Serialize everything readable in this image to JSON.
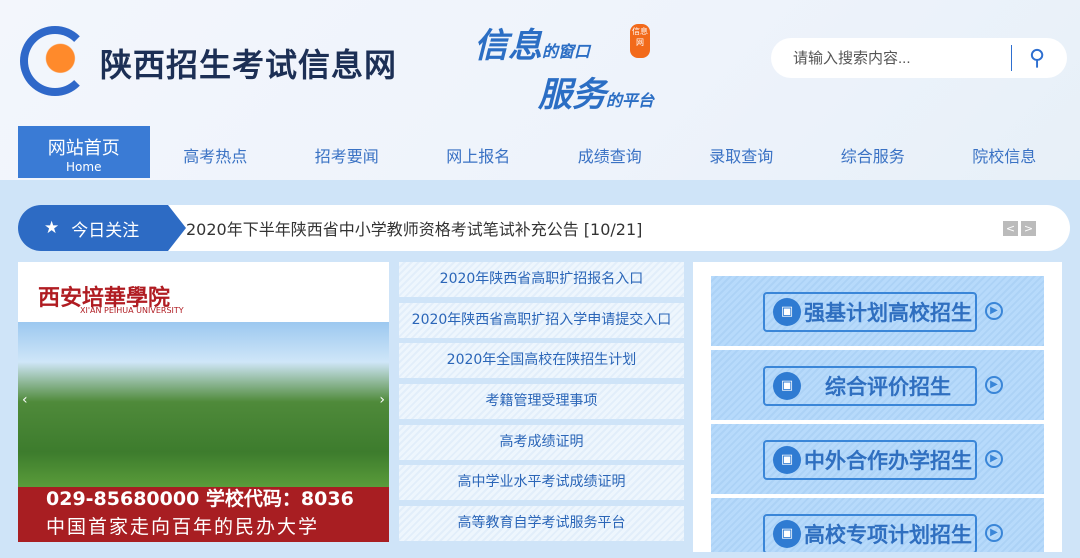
{
  "header": {
    "site_title": "陕西招生考试信息网",
    "slogan_line1_big": "信息",
    "slogan_line1_small": "的窗口",
    "slogan_line2_big": "服务",
    "slogan_line2_small": "的平台",
    "seal_text": "信息网",
    "search_placeholder": "请输入搜索内容..."
  },
  "nav": {
    "home_label": "网站首页",
    "home_en": "Home",
    "items": [
      "高考热点",
      "招考要闻",
      "网上报名",
      "成绩查询",
      "录取查询",
      "综合服务",
      "院校信息"
    ]
  },
  "today": {
    "label": "今日关注",
    "news": "2020年下半年陕西省中小学教师资格考试笔试补充公告  [10/21]",
    "prev": "<",
    "next": ">"
  },
  "banner": {
    "school_name": "西安培華學院",
    "school_en": "XI'AN PEIHUA UNIVERSITY",
    "phone": "029-85680000  学校代码：8036",
    "motto": "中国首家走向百年的民办大学"
  },
  "links": [
    "2020年陕西省高职扩招报名入口",
    "2020年陕西省高职扩招入学申请提交入口",
    "2020年全国高校在陕招生计划",
    "考籍管理受理事项",
    "高考成绩证明",
    "高中学业水平考试成绩证明",
    "高等教育自学考试服务平台"
  ],
  "panel": [
    "强基计划高校招生",
    "综合评价招生",
    "中外合作办学招生",
    "高校专项计划招生"
  ]
}
